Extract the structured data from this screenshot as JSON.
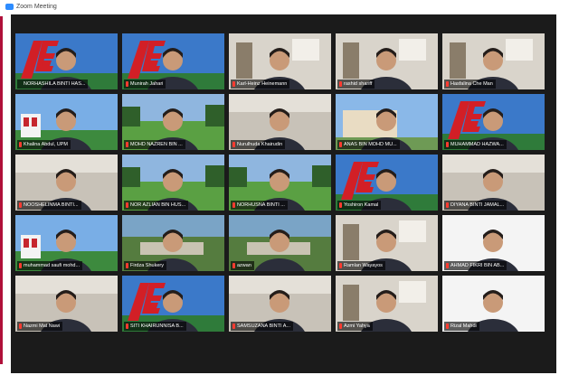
{
  "window": {
    "title": "Zoom Meeting"
  },
  "participants": [
    {
      "name": "NORHASHILA BINTI HAS...",
      "muted": false,
      "bg": "ae",
      "active": true
    },
    {
      "name": "Munirah Jahari",
      "muted": true,
      "bg": "ae"
    },
    {
      "name": "Karl-Heinz Heinemann",
      "muted": true,
      "bg": "office"
    },
    {
      "name": "rashid shariff",
      "muted": true,
      "bg": "office"
    },
    {
      "name": "Hasfalina Che Man",
      "muted": true,
      "bg": "office"
    },
    {
      "name": "Khalina Abdul, UPM",
      "muted": true,
      "bg": "campus"
    },
    {
      "name": "MOHD NAZREN BIN ...",
      "muted": true,
      "bg": "field"
    },
    {
      "name": "Nurulhuda Khairudin",
      "muted": true,
      "bg": "room"
    },
    {
      "name": "ANAS BIN MOHD MU...",
      "muted": true,
      "bg": "building"
    },
    {
      "name": "MUHAMMAD HAZWA...",
      "muted": true,
      "bg": "ae"
    },
    {
      "name": "NOOSHELINMA BINTI...",
      "muted": true,
      "bg": "room"
    },
    {
      "name": "NOR AZLIAN BIN HUS...",
      "muted": true,
      "bg": "field"
    },
    {
      "name": "NORHUSNA BINTI ...",
      "muted": true,
      "bg": "field"
    },
    {
      "name": "Yoshiron Kamal",
      "muted": true,
      "bg": "ae"
    },
    {
      "name": "DIYANA BINTI JAMAL...",
      "muted": true,
      "bg": "room"
    },
    {
      "name": "muhammad saufi mohd...",
      "muted": true,
      "bg": "campus"
    },
    {
      "name": "Firdza Shukery",
      "muted": true,
      "bg": "aerial"
    },
    {
      "name": "azwan",
      "muted": true,
      "bg": "aerial"
    },
    {
      "name": "Ramlan Wayayos",
      "muted": true,
      "bg": "office"
    },
    {
      "name": "AHMAD FIKRI BIN AB...",
      "muted": true,
      "bg": "white"
    },
    {
      "name": "Nazmi Mat Nawi",
      "muted": true,
      "bg": "room"
    },
    {
      "name": "SITI KHAIRUNNISA B...",
      "muted": true,
      "bg": "ae"
    },
    {
      "name": "SAMSUZANA BINTI A...",
      "muted": true,
      "bg": "room"
    },
    {
      "name": "Azmi Yahya",
      "muted": true,
      "bg": "office"
    },
    {
      "name": "Rizal Mahdi",
      "muted": true,
      "bg": "white"
    }
  ]
}
